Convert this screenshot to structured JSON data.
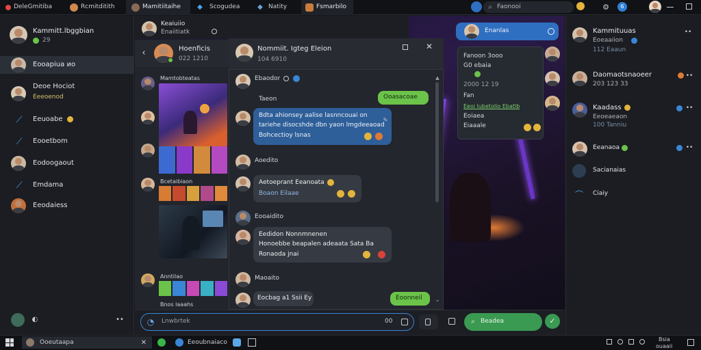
{
  "tabs": [
    "DeleGmitiba",
    "Rcmitditith",
    "Mamitiitaihe",
    "Scogudea",
    "Natity",
    "Fsmarbilo"
  ],
  "topbar": {
    "search_placeholder": "Faonooi",
    "badge_count": "6"
  },
  "left_sidebar": {
    "profile": {
      "name": "Kammitt.lbggbian",
      "status": "29"
    },
    "items": [
      {
        "label": "Eooapiua ио"
      },
      {
        "label": "Deoe Hociot",
        "sub": "Eeeoenod"
      },
      {
        "label": "Eeuoabe"
      },
      {
        "label": "Eooetbom"
      },
      {
        "label": "Eodoogaout"
      },
      {
        "label": "Emdama"
      },
      {
        "label": "Eeodaiess"
      }
    ]
  },
  "back_chat": {
    "name": "Keaiuiio",
    "sub": "Enaiitiatk"
  },
  "group_panel": {
    "name": "Hoenficis",
    "sub": "022 1210",
    "section1": "Mamtobteatas",
    "section2": "Bcetaibiaon",
    "section3": "Anntilao",
    "section4": "Bnos laaahs"
  },
  "chat": {
    "title": "Nommiit. Igteg Eleion",
    "subtitle": "104 6910",
    "messages": [
      {
        "author": "Ebaodor",
        "side": "left"
      },
      {
        "text": "Ooasacoae",
        "side": "right"
      },
      {
        "author": "Taeon",
        "side": "left"
      },
      {
        "lines": [
          "Bdta ahionsey aalise lasnncouai on",
          "tariehe disocshde dbn yaon lmgdeeaoad",
          "Bohcectioy lsnas"
        ],
        "side": "left"
      },
      {
        "author": "Aoedito",
        "side": "left"
      },
      {
        "lines": [
          "Aetoeprant Eeanoata",
          "Boaon Eilaae"
        ],
        "side": "left"
      },
      {
        "author": "Eooaidito",
        "side": "left"
      },
      {
        "lines": [
          "Eedidon Nonnmnenen",
          "Honoebbe beapalen adeaata Sata Ba",
          "Ronaoda jnai"
        ],
        "side": "left"
      },
      {
        "author": "Maoaito",
        "side": "left"
      },
      {
        "text": "Eocbag a1 Ssii Ey",
        "side": "left"
      },
      {
        "text": "Eoonneil",
        "side": "right"
      }
    ]
  },
  "composer": {
    "placeholder": "Lnwbrtek",
    "send_label": "Beadea",
    "count": "00"
  },
  "callout": {
    "name": "Enanlas",
    "lines": [
      "Fanoon 3ooo",
      "G0 ebaia",
      "2000 12 19",
      "Fan",
      "Eeoi lubetolio Ebatlb",
      "Eoiaea",
      "Eiaaale"
    ]
  },
  "right_sidebar": {
    "items": [
      {
        "name": "Kammituuas",
        "sub": "Eoeaaiion",
        "sub2": "112 Eaaun"
      },
      {
        "name": "Daomaotsnaoeer",
        "sub": "203 123 33"
      },
      {
        "name": "Kaadass",
        "sub": "Eeoeaeaon",
        "sub2": "100 Tanniu"
      },
      {
        "name": "Eeanaoa"
      },
      {
        "name": "Sacianaias"
      },
      {
        "name": "Ciaiy"
      }
    ]
  },
  "taskbar": {
    "search": "Ooeutaapa",
    "app1": "Eeoubnaiaco",
    "clock_line1": "Bsia",
    "clock_line2": "ouaaii"
  },
  "colors": {
    "accent_green": "#6cc34a",
    "accent_blue": "#3a86d6",
    "panel_bg": "#22252c"
  }
}
